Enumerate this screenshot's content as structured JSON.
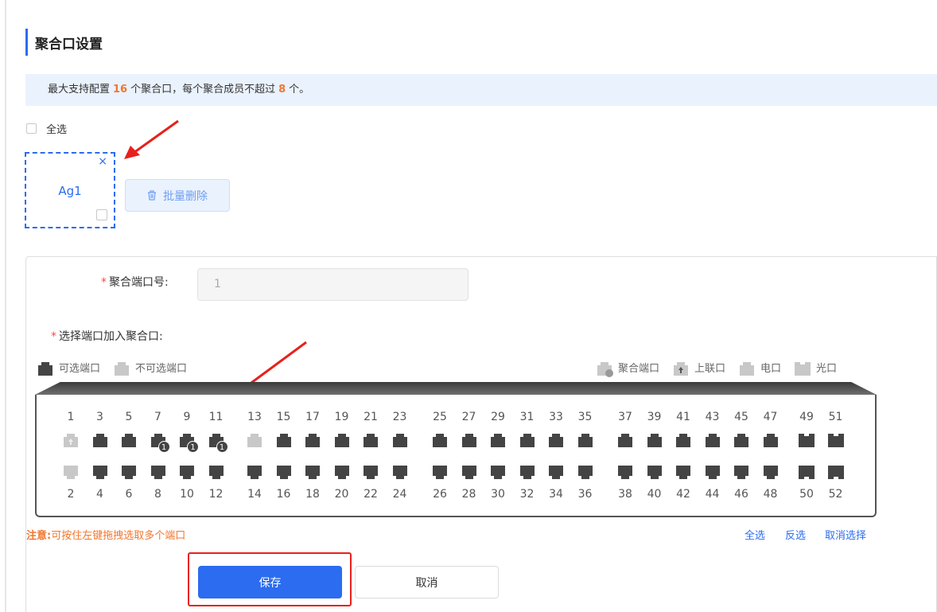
{
  "page_title": "聚合口设置",
  "notice": {
    "prefix": "最大支持配置",
    "max_ports": "16",
    "middle": "个聚合口，每个聚合成员不超过",
    "max_members": "8",
    "suffix": "个。"
  },
  "select_all_label": "全选",
  "aggregate_card": {
    "label": "Ag1",
    "close_symbol": "×"
  },
  "batch_delete_label": "批量删除",
  "form": {
    "required_mark": "*",
    "agg_port_label": "聚合端口号:",
    "agg_port_value": "1",
    "select_ports_label": "选择端口加入聚合口:"
  },
  "legend_left": [
    {
      "label": "可选端口",
      "color": "#444444"
    },
    {
      "label": "不可选端口",
      "color": "#c8c8c8"
    }
  ],
  "legend_right": [
    {
      "label": "聚合端口",
      "icon": "aggregate-port-icon"
    },
    {
      "label": "上联口",
      "icon": "uplink-port-icon"
    },
    {
      "label": "电口",
      "icon": "copper-port-icon"
    },
    {
      "label": "光口",
      "icon": "fiber-port-icon"
    }
  ],
  "ports": {
    "top_labels": [
      "1",
      "3",
      "5",
      "7",
      "9",
      "11",
      "13",
      "15",
      "17",
      "19",
      "21",
      "23",
      "25",
      "27",
      "29",
      "31",
      "33",
      "35",
      "37",
      "39",
      "41",
      "43",
      "45",
      "47",
      "49",
      "51"
    ],
    "bottom_labels": [
      "2",
      "4",
      "6",
      "8",
      "10",
      "12",
      "14",
      "16",
      "18",
      "20",
      "22",
      "24",
      "26",
      "28",
      "30",
      "32",
      "34",
      "36",
      "38",
      "40",
      "42",
      "44",
      "46",
      "48",
      "50",
      "52"
    ],
    "selected": [
      "7",
      "9",
      "11"
    ],
    "aggregate_badge": "1",
    "uplink": [
      "1"
    ],
    "unavailable": [
      "1",
      "2",
      "13"
    ],
    "fiber": [
      "49",
      "50",
      "51",
      "52"
    ]
  },
  "note": {
    "bold": "注意:",
    "text": "可按住左键拖拽选取多个端口"
  },
  "actions": {
    "select_all": "全选",
    "invert": "反选",
    "clear": "取消选择"
  },
  "buttons": {
    "save": "保存",
    "cancel": "取消"
  },
  "colors": {
    "accent": "#2b6cf0",
    "warning": "#f2762e",
    "highlight": "#e8201c",
    "port_dark": "#444444",
    "port_disabled": "#c8c8c8"
  }
}
